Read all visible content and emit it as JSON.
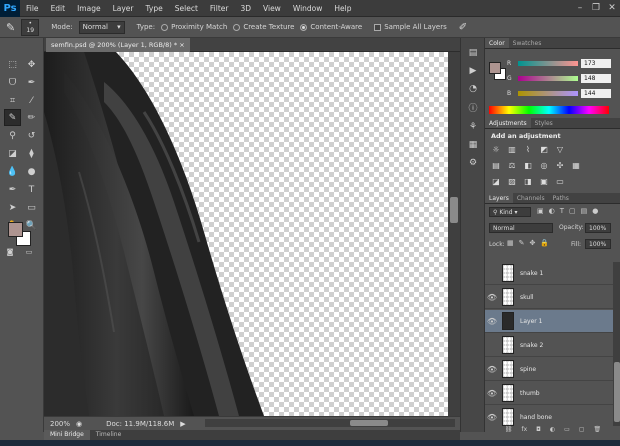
{
  "app": {
    "logo": "Ps"
  },
  "menu": [
    "File",
    "Edit",
    "Image",
    "Layer",
    "Type",
    "Select",
    "Filter",
    "3D",
    "View",
    "Window",
    "Help"
  ],
  "window_controls": [
    "–",
    "❐",
    "✕"
  ],
  "options": {
    "brush_size": "19",
    "mode_label": "Mode:",
    "mode_value": "Normal",
    "type_label": "Type:",
    "type_options": [
      "Proximity Match",
      "Create Texture",
      "Content-Aware"
    ],
    "type_selected": "Content-Aware",
    "sample_all_layers": "Sample All Layers"
  },
  "document": {
    "tab_title": "semfin.psd @ 200% (Layer 1, RGB/8) *",
    "zoom": "200%",
    "doc_size": "Doc: 11.9M/118.6M"
  },
  "bottom_tabs": [
    "Mini Bridge",
    "Timeline"
  ],
  "colors": {
    "foreground": "#ad9490",
    "background": "#ffffff"
  },
  "color_panel": {
    "tabs": [
      "Color",
      "Swatches"
    ],
    "R": "173",
    "G": "148",
    "B": "144"
  },
  "adjustments": {
    "tabs": [
      "Adjustments",
      "Styles"
    ],
    "heading": "Add an adjustment"
  },
  "layers_panel": {
    "tabs": [
      "Layers",
      "Channels",
      "Paths"
    ],
    "filter_kind": "Kind",
    "blend_mode": "Normal",
    "opacity_label": "Opacity:",
    "opacity_value": "100%",
    "lock_label": "Lock:",
    "fill_label": "Fill:",
    "fill_value": "100%",
    "layers": [
      {
        "name": "snake 1",
        "visible": false,
        "selected": false
      },
      {
        "name": "skull",
        "visible": true,
        "selected": false
      },
      {
        "name": "Layer 1",
        "visible": true,
        "selected": true
      },
      {
        "name": "snake 2",
        "visible": false,
        "selected": false
      },
      {
        "name": "spine",
        "visible": true,
        "selected": false
      },
      {
        "name": "thumb",
        "visible": true,
        "selected": false
      },
      {
        "name": "hand bone",
        "visible": true,
        "selected": false
      }
    ]
  }
}
